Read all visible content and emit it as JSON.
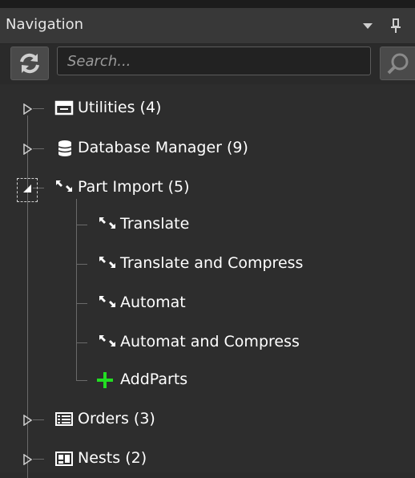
{
  "panel": {
    "title": "Navigation",
    "search_placeholder": "Search...",
    "icons": {
      "dropdown": "chevron-down-icon",
      "pin": "pin-icon",
      "refresh": "refresh-icon",
      "search": "search-icon"
    }
  },
  "tree": {
    "items": [
      {
        "label": "Utilities (4)",
        "icon": "window-icon",
        "state": "collapsed"
      },
      {
        "label": "Database Manager (9)",
        "icon": "database-icon",
        "state": "collapsed"
      },
      {
        "label": "Part Import (5)",
        "icon": "import-arrows-icon",
        "state": "expanded",
        "children": [
          {
            "label": "Translate",
            "icon": "import-arrows-icon"
          },
          {
            "label": "Translate and Compress",
            "icon": "import-arrows-icon"
          },
          {
            "label": "Automat",
            "icon": "import-arrows-icon"
          },
          {
            "label": "Automat and Compress",
            "icon": "import-arrows-icon"
          },
          {
            "label": "AddParts",
            "icon": "add-icon"
          }
        ]
      },
      {
        "label": "Orders (3)",
        "icon": "list-icon",
        "state": "collapsed"
      },
      {
        "label": "Nests (2)",
        "icon": "nests-icon",
        "state": "collapsed"
      }
    ]
  },
  "colors": {
    "background": "#2d2d2d",
    "header": "#383838",
    "text": "#ffffff",
    "add_icon": "#22dd22",
    "arrows": "#ffffff"
  }
}
